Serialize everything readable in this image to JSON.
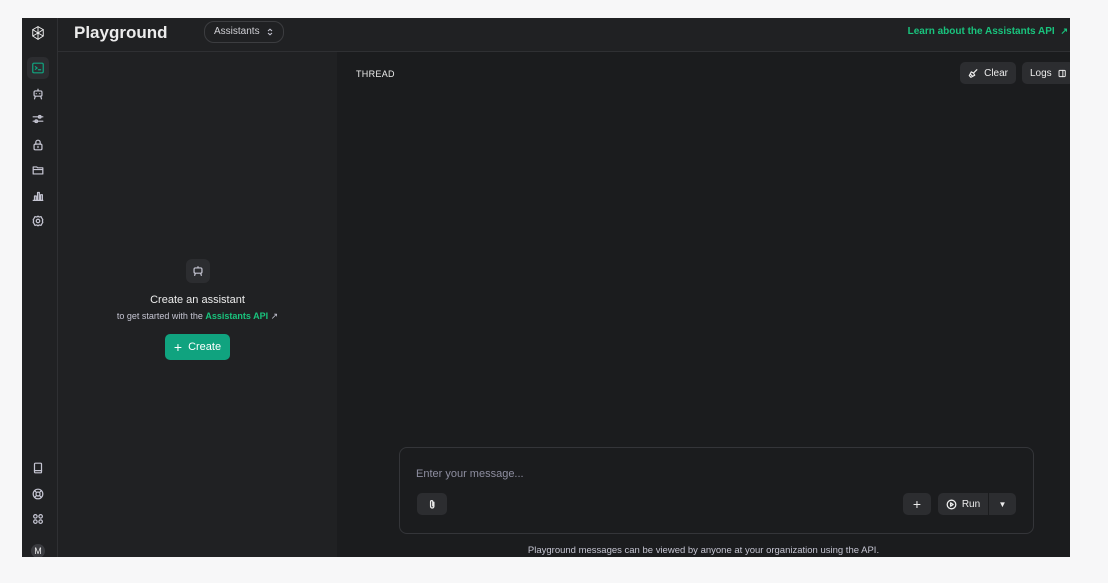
{
  "header": {
    "title": "Playground",
    "mode_select": "Assistants",
    "learn_link": "Learn about the Assistants API",
    "learn_link_icon": "arrow-up-right-icon"
  },
  "rail": {
    "top_items": [
      {
        "name": "playground",
        "icon": "terminal-icon",
        "active": true
      },
      {
        "name": "assistants",
        "icon": "robot-icon",
        "active": false
      },
      {
        "name": "fine-tuning",
        "icon": "sliders-icon",
        "active": false
      },
      {
        "name": "api-keys",
        "icon": "lock-icon",
        "active": false
      },
      {
        "name": "storage",
        "icon": "folder-icon",
        "active": false
      },
      {
        "name": "usage",
        "icon": "bar-chart-icon",
        "active": false
      },
      {
        "name": "settings",
        "icon": "gear-icon",
        "active": false
      }
    ],
    "bottom_items": [
      {
        "name": "docs",
        "icon": "book-icon"
      },
      {
        "name": "help",
        "icon": "lifebuoy-icon"
      },
      {
        "name": "apps",
        "icon": "grid-icon"
      }
    ],
    "avatar_initial": "M"
  },
  "assistant_panel": {
    "icon": "robot-icon",
    "title": "Create an assistant",
    "subtitle_prefix": "to get started with the",
    "subtitle_link": "Assistants API",
    "create_label": "Create"
  },
  "thread": {
    "label": "THREAD",
    "clear_label": "Clear",
    "logs_label": "Logs",
    "composer": {
      "placeholder": "Enter your message...",
      "run_label": "Run"
    },
    "note": "Playground messages can be viewed by anyone at your organization using the API."
  },
  "colors": {
    "accent": "#10a37f",
    "link": "#19c37d",
    "background": "#202123",
    "thread_background": "#1b1c1e"
  }
}
